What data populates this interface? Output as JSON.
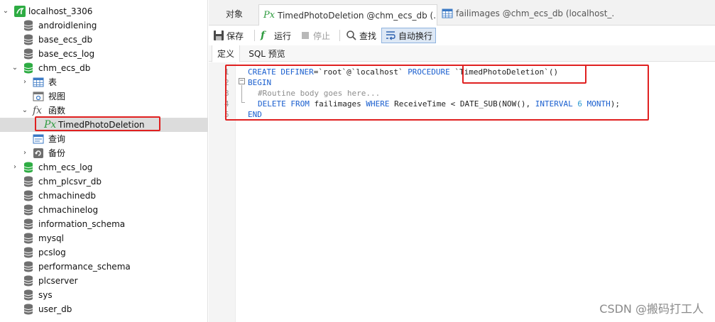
{
  "sidebar": {
    "connection": "localhost_3306",
    "databases_top": [
      "androidlening",
      "base_ecs_db",
      "base_ecs_log"
    ],
    "expanded_db": "chm_ecs_db",
    "groups": {
      "tables": "表",
      "views": "视图",
      "functions": "函数",
      "queries": "查询",
      "backups": "备份"
    },
    "selected_function": "TimedPhotoDeletion",
    "databases_bottom": [
      "chm_ecs_log",
      "chm_plcsvr_db",
      "chmachinedb",
      "chmachinelog",
      "information_schema",
      "mysql",
      "pcslog",
      "performance_schema",
      "plcserver",
      "sys",
      "user_db"
    ]
  },
  "tabs": {
    "objects": "对象",
    "function_tab": "TimedPhotoDeletion @chm_ecs_db (...",
    "table_tab": "failimages @chm_ecs_db (localhost_..."
  },
  "toolbar": {
    "save": "保存",
    "run": "运行",
    "stop": "停止",
    "find": "查找",
    "wrap": "自动换行"
  },
  "subtabs": {
    "definition": "定义",
    "sql_preview": "SQL 预览"
  },
  "editor": {
    "line_numbers": [
      "1",
      "2",
      "3",
      "4",
      "5"
    ],
    "line1": {
      "kw1": "CREATE",
      "kw2": "DEFINER",
      "mid": "=`root`@`localhost` ",
      "kw3": "PROCEDURE",
      "name": " `TimedPhotoDeletion`()"
    },
    "line2": {
      "kw": "BEGIN"
    },
    "line3": {
      "comment": "#Routine body goes here..."
    },
    "line4": {
      "kw1": "DELETE",
      "kw2": "FROM",
      "t1": " failimages ",
      "kw3": "WHERE",
      "t2": " ReceiveTime < DATE_SUB(NOW(), ",
      "kw4": "INTERVAL",
      "num": "6",
      "kw5": "MONTH",
      "t3": ");"
    },
    "line5": {
      "kw": "END"
    }
  },
  "watermark": "CSDN @搬码打工人",
  "colors": {
    "keyword": "#1a5fcf",
    "comment": "#8e8e8e",
    "highlight_border": "#e02020",
    "db_connected": "#2eac43"
  }
}
